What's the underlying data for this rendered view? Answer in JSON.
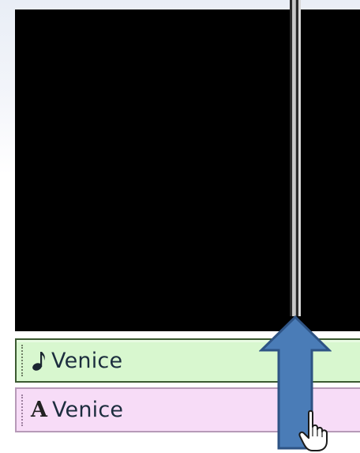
{
  "timeline": {
    "audio_clip": {
      "label": "Venice",
      "icon": "music-note-icon"
    },
    "title_clip": {
      "label": "Venice",
      "icon_glyph": "A",
      "icon": "title-text-icon"
    }
  },
  "colors": {
    "audio_track_bg": "#d8f7cf",
    "audio_track_border": "#3b5a31",
    "title_track_bg": "#f7dcf7",
    "title_track_border": "#b79ab8",
    "arrow_fill": "#4a7cb7",
    "arrow_stroke": "#2e5384",
    "preview_bg": "#000000"
  }
}
